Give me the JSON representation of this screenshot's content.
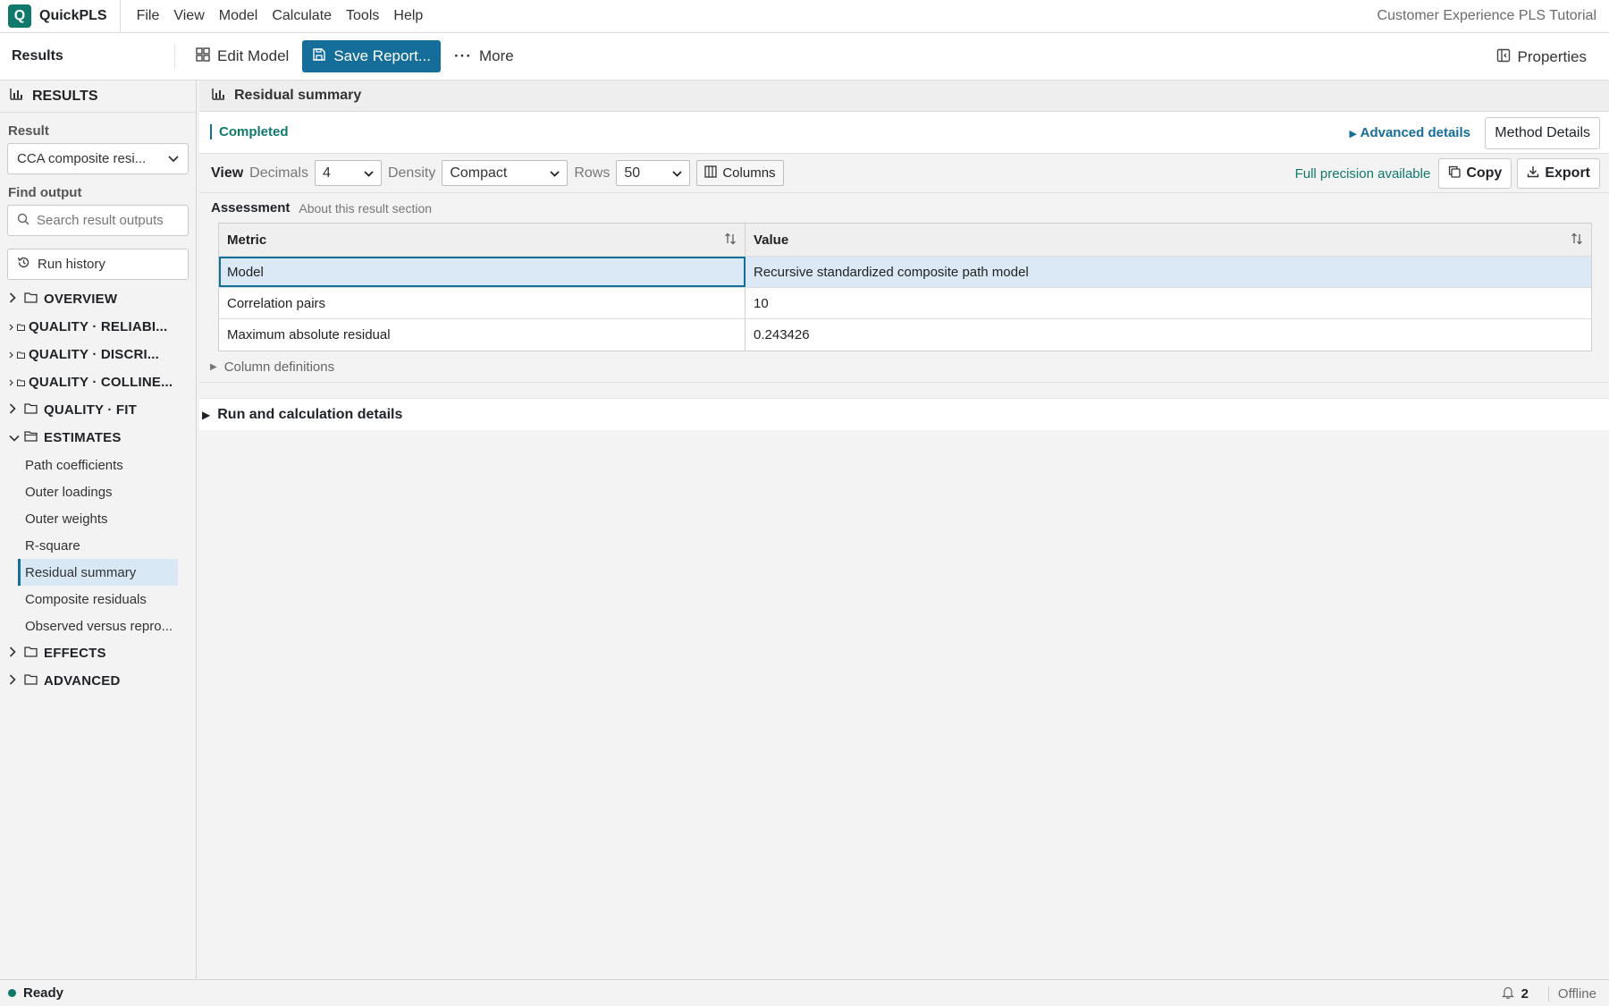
{
  "app": {
    "logo_letter": "Q",
    "name": "QuickPLS",
    "window_title": "Customer Experience PLS Tutorial",
    "menu": [
      "File",
      "View",
      "Model",
      "Calculate",
      "Tools",
      "Help"
    ]
  },
  "toolbar": {
    "section": "Results",
    "edit_model": "Edit Model",
    "save_report": "Save Report...",
    "more": "More",
    "properties": "Properties"
  },
  "sidebar": {
    "header": "RESULTS",
    "result_label": "Result",
    "result_value": "CCA composite resi...",
    "find_label": "Find output",
    "search_placeholder": "Search result outputs",
    "run_history": "Run history",
    "groups": {
      "overview": "OVERVIEW",
      "quality_reliability": "QUALITY · RELIABI...",
      "quality_discriminant": "QUALITY · DISCRI...",
      "quality_collinearity": "QUALITY · COLLINE...",
      "quality_fit": "QUALITY · FIT",
      "estimates": "ESTIMATES",
      "effects": "EFFECTS",
      "advanced": "ADVANCED"
    },
    "estimates_items": [
      "Path coefficients",
      "Outer loadings",
      "Outer weights",
      "R-square",
      "Residual summary",
      "Composite residuals",
      "Observed versus repro..."
    ],
    "active_item": "Residual summary"
  },
  "main": {
    "panel_title": "Residual summary",
    "status": "Completed",
    "advanced_details": "Advanced details",
    "method_details": "Method Details",
    "view": {
      "label": "View",
      "decimals_label": "Decimals",
      "decimals_value": "4",
      "density_label": "Density",
      "density_value": "Compact",
      "rows_label": "Rows",
      "rows_value": "50",
      "columns": "Columns",
      "full_precision": "Full precision available",
      "copy": "Copy",
      "export": "Export"
    },
    "section_title": "Assessment",
    "section_note": "About this result section",
    "table": {
      "headers": [
        "Metric",
        "Value"
      ],
      "rows": [
        [
          "Model",
          "Recursive standardized composite path model"
        ],
        [
          "Correlation pairs",
          "10"
        ],
        [
          "Maximum absolute residual",
          "0.243426"
        ]
      ]
    },
    "column_definitions": "Column definitions",
    "run_details": "Run and calculation details"
  },
  "statusbar": {
    "ready": "Ready",
    "notifications": "2",
    "connection": "Offline"
  },
  "colors": {
    "accent": "#156e9a",
    "success": "#0f7a6c"
  }
}
